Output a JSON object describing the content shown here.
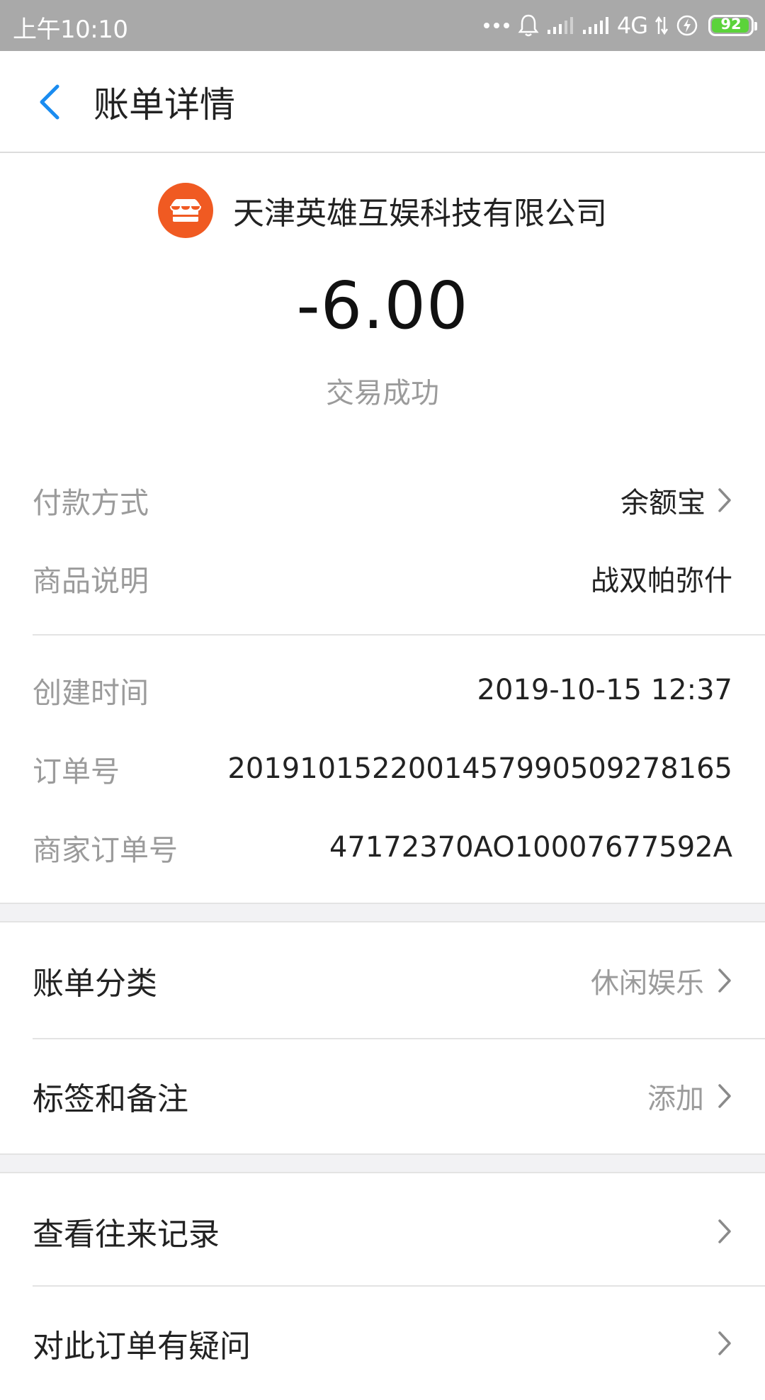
{
  "status_bar": {
    "time": "上午10:10",
    "network": "4G",
    "battery": "92",
    "battery_color": "#5bd33a",
    "icons": [
      "more-dots-icon",
      "bell-icon",
      "signal-weak-icon",
      "signal-icon",
      "data-arrows-icon",
      "charging-icon",
      "battery-icon"
    ]
  },
  "header": {
    "title": "账单详情",
    "back_icon": "back-chevron-icon",
    "accent_color": "#1a8cf0"
  },
  "merchant": {
    "name": "天津英雄互娱科技有限公司",
    "logo_icon": "store-icon",
    "logo_color": "#f05a22"
  },
  "transaction": {
    "amount": "-6.00",
    "status": "交易成功"
  },
  "details": {
    "payment_method": {
      "label": "付款方式",
      "value": "余额宝"
    },
    "product_desc": {
      "label": "商品说明",
      "value": "战双帕弥什"
    },
    "created_time": {
      "label": "创建时间",
      "value": "2019-10-15 12:37"
    },
    "order_no": {
      "label": "订单号",
      "value": "2019101522001457990509278165"
    },
    "merchant_order_no": {
      "label": "商家订单号",
      "value": "47172370AO10007677592A"
    }
  },
  "settings": {
    "category": {
      "label": "账单分类",
      "value": "休闲娱乐"
    },
    "tags": {
      "label": "标签和备注",
      "value": "添加"
    }
  },
  "actions": {
    "history": {
      "label": "查看往来记录"
    },
    "question": {
      "label": "对此订单有疑问"
    }
  }
}
